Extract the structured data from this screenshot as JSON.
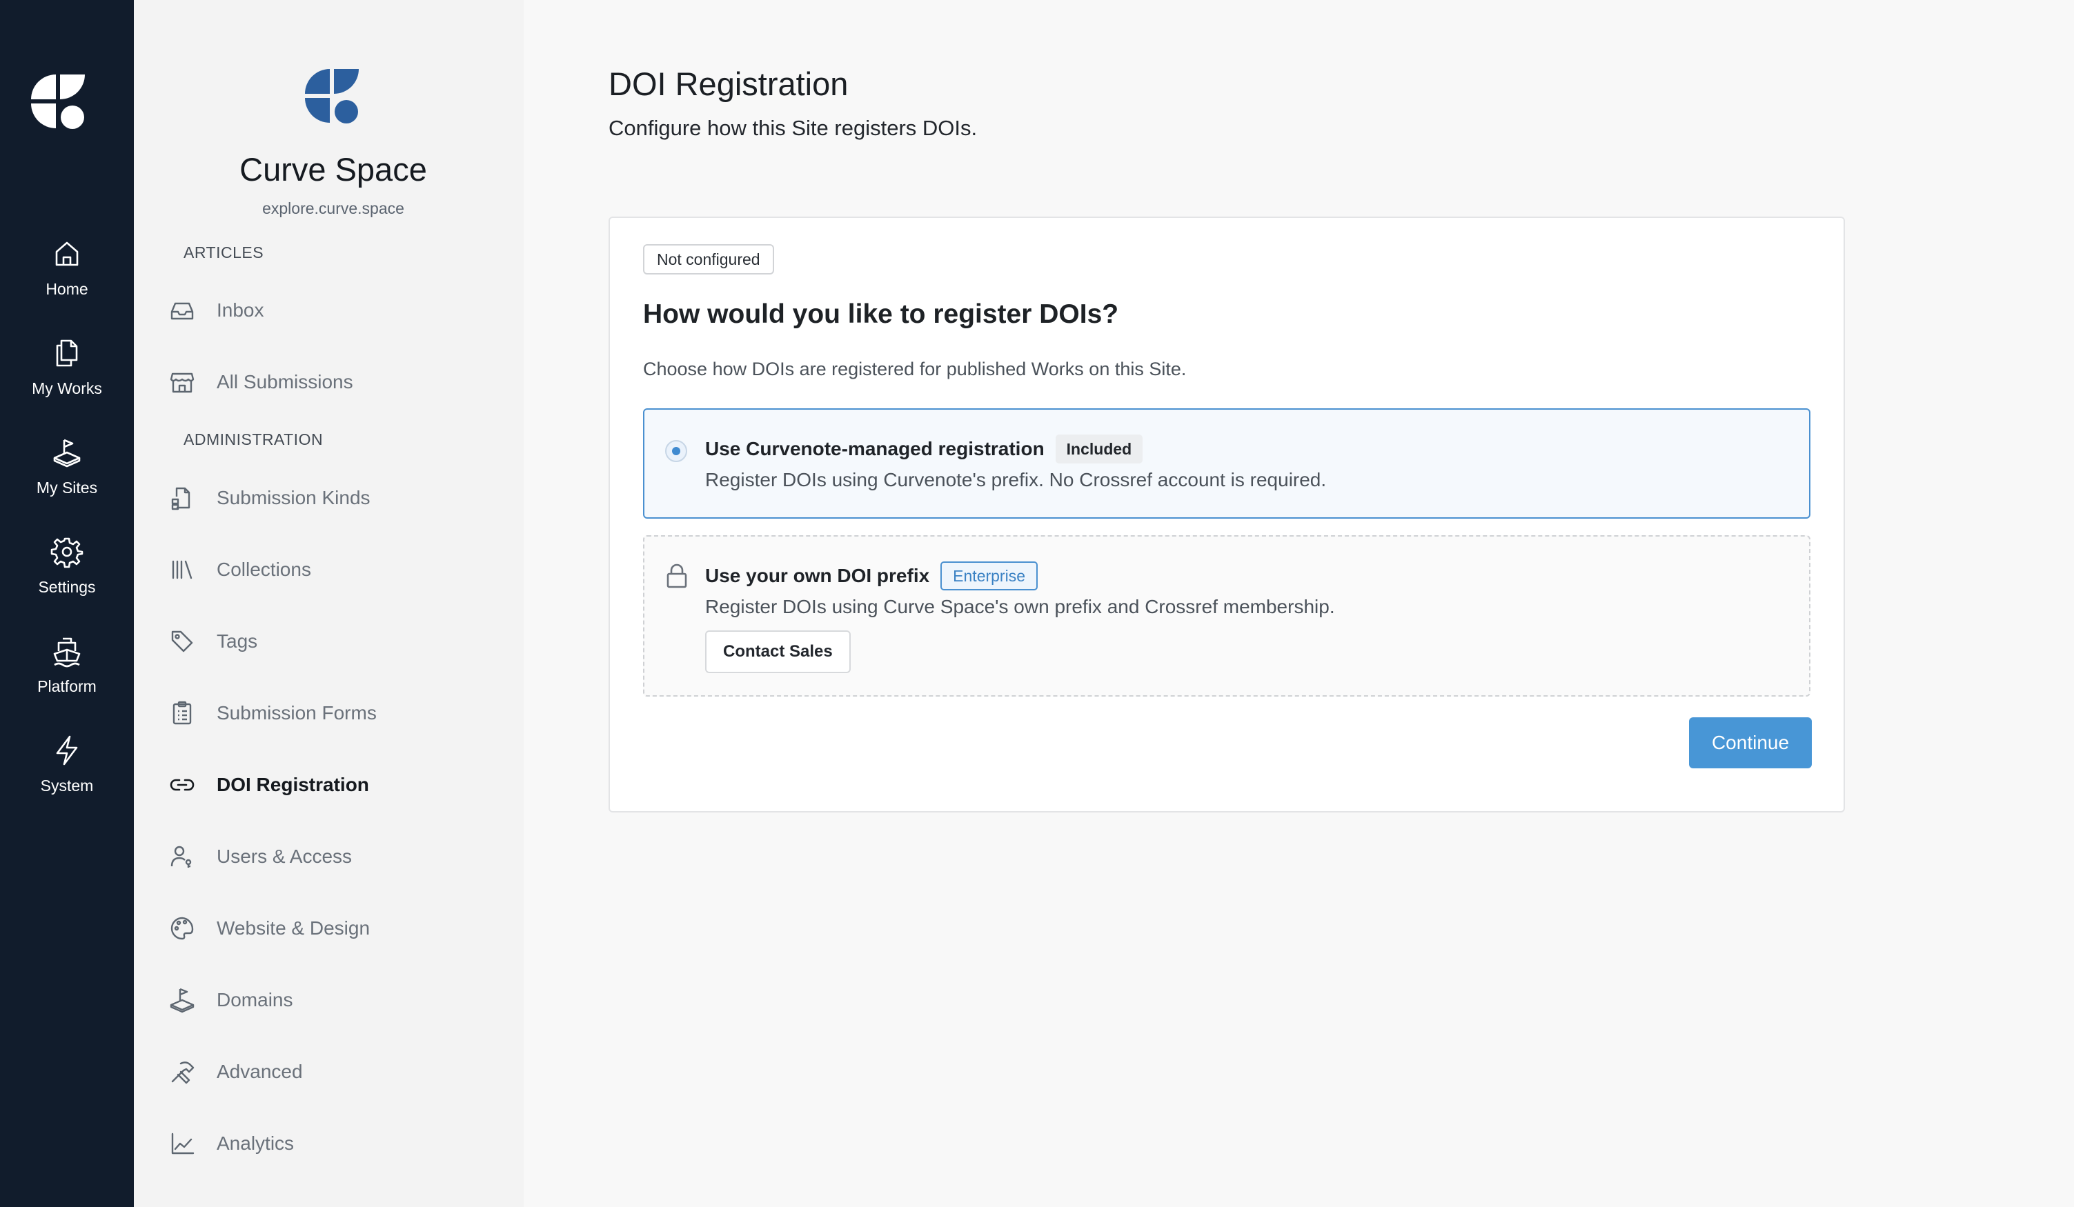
{
  "rail": {
    "logo_icon": "curvenote-logo-icon",
    "items": [
      {
        "label": "Home",
        "icon": "home-icon"
      },
      {
        "label": "My Works",
        "icon": "documents-icon"
      },
      {
        "label": "My Sites",
        "icon": "sites-icon"
      },
      {
        "label": "Settings",
        "icon": "gear-icon"
      },
      {
        "label": "Platform",
        "icon": "ship-icon"
      },
      {
        "label": "System",
        "icon": "lightning-icon"
      }
    ]
  },
  "sidebar": {
    "site_name": "Curve Space",
    "site_url": "explore.curve.space",
    "articles_heading": "ARTICLES",
    "administration_heading": "ADMINISTRATION",
    "articles_items": [
      {
        "label": "Inbox",
        "icon": "inbox-icon"
      },
      {
        "label": "All Submissions",
        "icon": "storefront-icon"
      }
    ],
    "admin_items": [
      {
        "label": "Submission Kinds",
        "icon": "file-kinds-icon"
      },
      {
        "label": "Collections",
        "icon": "library-icon"
      },
      {
        "label": "Tags",
        "icon": "tag-icon"
      },
      {
        "label": "Submission Forms",
        "icon": "clipboard-icon"
      },
      {
        "label": "DOI Registration",
        "icon": "link-icon",
        "active": true
      },
      {
        "label": "Users & Access",
        "icon": "user-key-icon"
      },
      {
        "label": "Website & Design",
        "icon": "palette-icon"
      },
      {
        "label": "Domains",
        "icon": "domains-icon"
      },
      {
        "label": "Advanced",
        "icon": "tools-icon"
      },
      {
        "label": "Analytics",
        "icon": "chart-line-icon"
      }
    ]
  },
  "main": {
    "title": "DOI Registration",
    "subtitle": "Configure how this Site registers DOIs.",
    "card": {
      "status_badge": "Not configured",
      "heading": "How would you like to register DOIs?",
      "description": "Choose how DOIs are registered for published Works on this Site.",
      "option_managed": {
        "title": "Use Curvenote-managed registration",
        "tag": "Included",
        "description": "Register DOIs using Curvenote's prefix. No Crossref account is required.",
        "selected": true
      },
      "option_own": {
        "title": "Use your own DOI prefix",
        "tag": "Enterprise",
        "description": "Register DOIs using Curve Space's own prefix and Crossref membership.",
        "button": "Contact Sales",
        "locked": true
      },
      "continue_button": "Continue"
    }
  },
  "colors": {
    "rail_bg": "#111c2c",
    "sidebar_bg": "#f3f3f3",
    "accent": "#4896d6",
    "brand_logo": "#2c5f9e"
  }
}
